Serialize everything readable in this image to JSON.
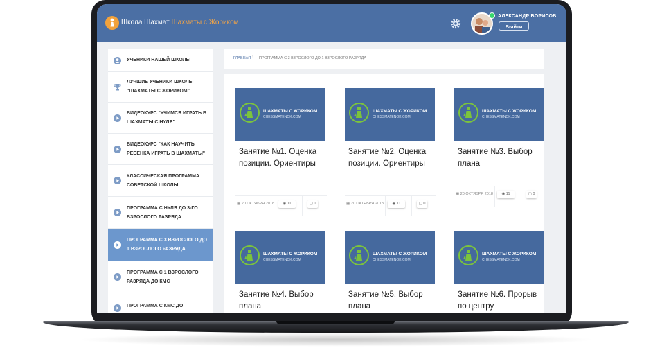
{
  "header": {
    "brand_prefix": "Школа Шахмат",
    "brand_accent": "Шахматы с Жориком",
    "user_name": "АЛЕКСАНДР БОРИСОВ",
    "logout_label": "Выйти",
    "settings_icon": "gear-icon",
    "colors": {
      "header_bg": "#4b6fa4",
      "accent": "#f6a544",
      "online": "#36d66c"
    }
  },
  "sidebar": {
    "items": [
      {
        "label": "УЧЕНИКИ НАШЕЙ ШКОЛЫ",
        "icon": "user-icon",
        "active": false
      },
      {
        "label": "ЛУЧШИЕ УЧЕНИКИ ШКОЛЫ \"ШАХМАТЫ С ЖОРИКОМ\"",
        "icon": "trophy-icon",
        "active": false
      },
      {
        "label": "ВИДЕОКУРС \"УЧИМСЯ ИГРАТЬ В ШАХМАТЫ С НУЛЯ\"",
        "icon": "play-icon",
        "active": false
      },
      {
        "label": "ВИДЕОКУРС \"КАК НАУЧИТЬ РЕБЕНКА ИГРАТЬ В ШАХМАТЫ\"",
        "icon": "play-icon",
        "active": false
      },
      {
        "label": "КЛАССИЧЕСКАЯ ПРОГРАММА СОВЕТСКОЙ ШКОЛЫ",
        "icon": "play-icon",
        "active": false
      },
      {
        "label": "ПРОГРАММА С НУЛЯ ДО 3-ГО ВЗРОСЛОГО РАЗРЯДА",
        "icon": "play-icon",
        "active": false
      },
      {
        "label": "ПРОГРАММА С 3 ВЗРОСЛОГО ДО 1 ВЗРОСЛОГО РАЗРЯДА",
        "icon": "play-icon",
        "active": true
      },
      {
        "label": "ПРОГРАММА С 1 ВЗРОСЛОГО РАЗРЯДА ДО КМС",
        "icon": "play-icon",
        "active": false
      },
      {
        "label": "ПРОГРАММА С КМС ДО",
        "icon": "play-icon",
        "active": false
      }
    ],
    "active_color": "#6c97cd"
  },
  "breadcrumb": {
    "home": "ГЛАВНАЯ",
    "separator": "›",
    "current": "ПРОГРАММА С 3 ВЗРОСЛОГО ДО 1 ВЗРОСЛОГО РАЗРЯДА"
  },
  "thumbnail": {
    "title": "ШАХМАТЫ С ЖОРИКОМ",
    "url": "CHESSMATENOK.COM",
    "bg_color": "#45699e"
  },
  "lessons": [
    {
      "title": "Занятие №1. Оценка позиции. Ориентиры",
      "date": "20 ОКТЯБРЯ 2018",
      "views": "11",
      "comments": "0"
    },
    {
      "title": "Занятие №2. Оценка позиции. Ориентиры",
      "date": "20 ОКТЯБРЯ 2018",
      "views": "11",
      "comments": "0"
    },
    {
      "title": "Занятие №3. Выбор плана",
      "date": "20 ОКТЯБРЯ 2018",
      "views": "11",
      "comments": "0"
    },
    {
      "title": "Занятие №4. Выбор плана",
      "date": "",
      "views": "",
      "comments": ""
    },
    {
      "title": "Занятие №5. Выбор плана",
      "date": "",
      "views": "",
      "comments": ""
    },
    {
      "title": "Занятие №6. Прорыв по центру",
      "date": "",
      "views": "",
      "comments": ""
    }
  ]
}
